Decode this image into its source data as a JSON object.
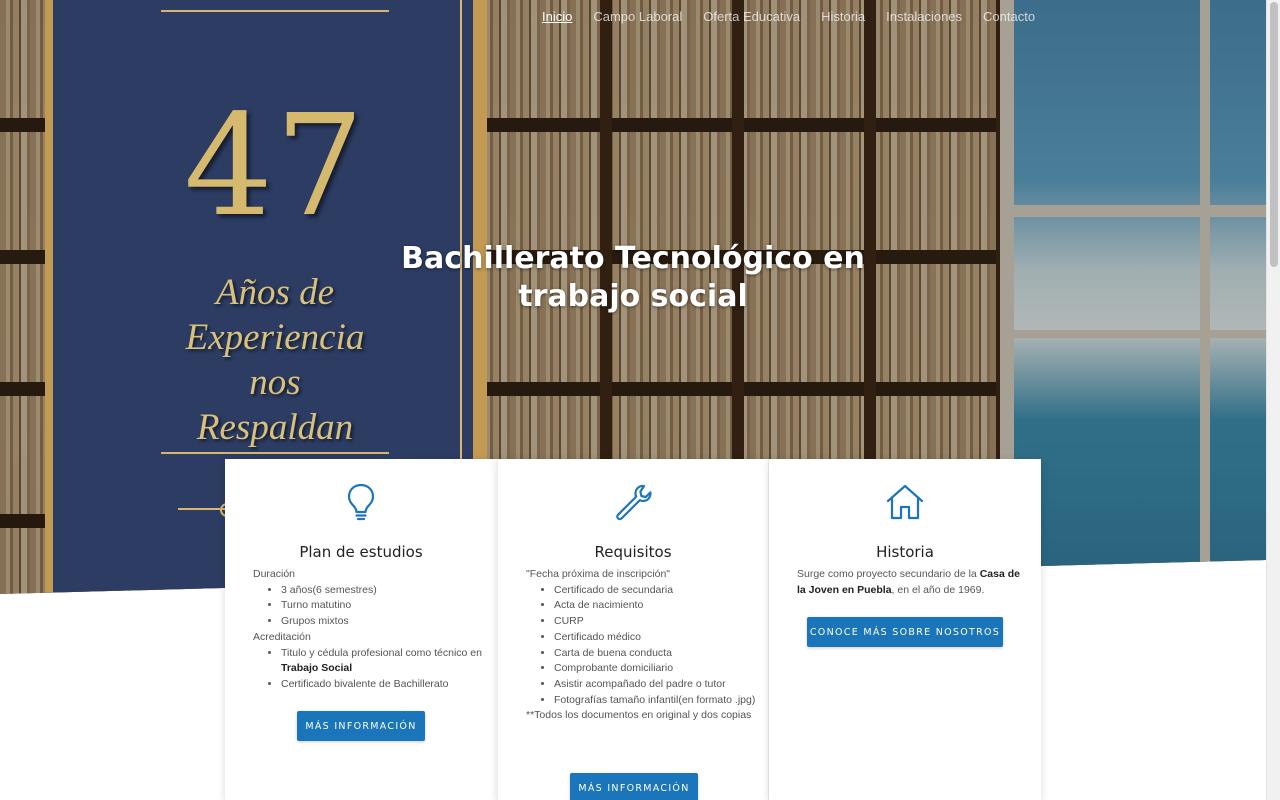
{
  "nav": {
    "items": [
      {
        "label": "Inicio",
        "active": true
      },
      {
        "label": "Campo Laboral"
      },
      {
        "label": "Oferta Educativa"
      },
      {
        "label": "Historia"
      },
      {
        "label": "Instalaciones"
      },
      {
        "label": "Contacto"
      }
    ]
  },
  "hero": {
    "title": "Bachillerato Tecnológico en trabajo social",
    "poster": {
      "number": "47",
      "lines": [
        "Años de",
        "Experiencia",
        "nos",
        "Respaldan"
      ]
    }
  },
  "cards": [
    {
      "icon": "lightbulb-icon",
      "title": "Plan de estudios",
      "groups": [
        {
          "heading": "Duración",
          "items": [
            "3 años(6 semestres)",
            "Turno matutino",
            "Grupos mixtos"
          ]
        },
        {
          "heading": "Acreditación",
          "items_pre": "Titulo y cédula profesional como técnico en ",
          "items_bold": "Trabajo Social",
          "item2": "Certificado bivalente de Bachillerato"
        }
      ],
      "button": "MÁS INFORMACIÓN"
    },
    {
      "icon": "wrench-icon",
      "title": "Requisitos",
      "intro": "\"Fecha próxima de inscripción\"",
      "items": [
        "Certificado de secundaria",
        "Acta de nacimiento",
        "CURP",
        "Certificado médico",
        "Carta de buena conducta",
        "Comprobante domiciliario",
        "Asistir acompañado del padre o tutor",
        "Fotografías tamaño infantil(en formato .jpg)"
      ],
      "note": "**Todos los documentos en original y dos copias",
      "button": "MÁS INFORMACIÓN"
    },
    {
      "icon": "house-icon",
      "title": "Historia",
      "text_pre": "Surge como proyecto secundario de la ",
      "text_bold": "Casa de la Joven en Puebla",
      "text_post": ", en el año de 1969.",
      "button": "CONOCE MÁS SOBRE NOSOTROS"
    }
  ],
  "colors": {
    "accent": "#1b75bb",
    "icon": "#1b75bb",
    "poster_bg": "#2c3c63",
    "gold": "#d5b96f"
  }
}
